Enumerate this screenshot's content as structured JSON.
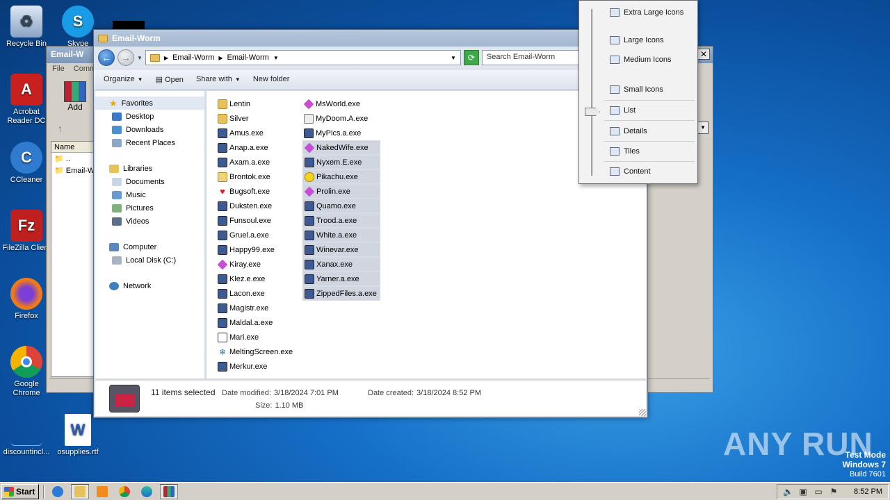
{
  "desktop": {
    "icons": [
      {
        "label": "Recycle Bin",
        "icon": "recycle-bin-icon",
        "color": "#9fb8d8"
      },
      {
        "label": "Acrobat Reader DC",
        "icon": "acrobat-icon",
        "color": "#c8201e"
      },
      {
        "label": "CCleaner",
        "icon": "ccleaner-icon",
        "color": "#2f7bd0"
      },
      {
        "label": "FileZilla Client",
        "icon": "filezilla-icon",
        "color": "#bf1f1f"
      },
      {
        "label": "Firefox",
        "icon": "firefox-icon",
        "color": "#f07a1a"
      },
      {
        "label": "Google Chrome",
        "icon": "chrome-icon",
        "color": "#e9b400"
      },
      {
        "label": "Skype",
        "icon": "skype-icon",
        "color": "#1a9be6"
      },
      {
        "label": "discountincl...",
        "icon": "file-icon",
        "color": "#3a6fb8"
      },
      {
        "label": "osupplies.rtf",
        "icon": "word-document-icon",
        "color": "#2b5bb5"
      }
    ],
    "watermark": "ANY RUN",
    "test_mode": {
      "line1": "Test Mode",
      "line2": "Windows 7",
      "line3": "Build 7601"
    }
  },
  "winrar": {
    "title": "Email-W",
    "menu": [
      "File",
      "Comm"
    ],
    "add_label": "Add",
    "column_name": "Name",
    "rows": [
      "..",
      "Email-W"
    ]
  },
  "explorer": {
    "title": "Email-Worm",
    "breadcrumb": [
      "Email-Worm",
      "Email-Worm"
    ],
    "search_placeholder": "Search Email-Worm",
    "commands": {
      "organize": "Organize",
      "open": "Open",
      "share_with": "Share with",
      "new_folder": "New folder"
    },
    "nav": {
      "favorites": "Favorites",
      "fav_items": [
        "Desktop",
        "Downloads",
        "Recent Places"
      ],
      "libraries": "Libraries",
      "lib_items": [
        "Documents",
        "Music",
        "Pictures",
        "Videos"
      ],
      "computer": "Computer",
      "comp_items": [
        "Local Disk (C:)"
      ],
      "network": "Network"
    },
    "files_col1": [
      {
        "name": "Lentin",
        "icon": "folder-icon",
        "selected": false
      },
      {
        "name": "Silver",
        "icon": "folder-icon",
        "selected": false
      },
      {
        "name": "Amus.exe",
        "icon": "exe-icon",
        "selected": false
      },
      {
        "name": "Anap.a.exe",
        "icon": "exe-icon",
        "selected": false
      },
      {
        "name": "Axam.a.exe",
        "icon": "exe-icon",
        "selected": false
      },
      {
        "name": "Brontok.exe",
        "icon": "folder-exe-icon",
        "selected": false
      },
      {
        "name": "Bugsoft.exe",
        "icon": "heart-icon",
        "selected": false
      },
      {
        "name": "Duksten.exe",
        "icon": "exe-icon",
        "selected": false
      },
      {
        "name": "Funsoul.exe",
        "icon": "exe-icon",
        "selected": false
      },
      {
        "name": "Gruel.a.exe",
        "icon": "exe-icon",
        "selected": false
      },
      {
        "name": "Happy99.exe",
        "icon": "exe-icon",
        "selected": false
      },
      {
        "name": "Kiray.exe",
        "icon": "diamond-icon",
        "selected": false
      },
      {
        "name": "Klez.e.exe",
        "icon": "exe-icon",
        "selected": false
      },
      {
        "name": "Lacon.exe",
        "icon": "exe-icon",
        "selected": false
      },
      {
        "name": "Magistr.exe",
        "icon": "exe-icon",
        "selected": false
      },
      {
        "name": "Maldal.a.exe",
        "icon": "exe-icon",
        "selected": false
      },
      {
        "name": "Mari.exe",
        "icon": "window-icon",
        "selected": false
      },
      {
        "name": "MeltingScreen.exe",
        "icon": "snowflake-icon",
        "selected": false
      },
      {
        "name": "Merkur.exe",
        "icon": "exe-icon",
        "selected": false
      }
    ],
    "files_col2": [
      {
        "name": "MsWorld.exe",
        "icon": "diamond-icon",
        "selected": false
      },
      {
        "name": "MyDoom.A.exe",
        "icon": "document-icon",
        "selected": false
      },
      {
        "name": "MyPics.a.exe",
        "icon": "exe-icon",
        "selected": false
      },
      {
        "name": "NakedWife.exe",
        "icon": "diamond-icon",
        "selected": true
      },
      {
        "name": "Nyxem.E.exe",
        "icon": "exe-icon",
        "selected": true
      },
      {
        "name": "Pikachu.exe",
        "icon": "smiley-icon",
        "selected": true
      },
      {
        "name": "Prolin.exe",
        "icon": "diamond-icon",
        "selected": true
      },
      {
        "name": "Quamo.exe",
        "icon": "exe-icon",
        "selected": true
      },
      {
        "name": "Trood.a.exe",
        "icon": "exe-icon",
        "selected": true
      },
      {
        "name": "White.a.exe",
        "icon": "exe-icon",
        "selected": true
      },
      {
        "name": "Winevar.exe",
        "icon": "exe-icon",
        "selected": true
      },
      {
        "name": "Xanax.exe",
        "icon": "exe-icon",
        "selected": true
      },
      {
        "name": "Yarner.a.exe",
        "icon": "exe-icon",
        "selected": true
      },
      {
        "name": "ZippedFiles.a.exe",
        "icon": "exe-icon",
        "selected": true
      }
    ],
    "details": {
      "count": "11 items selected",
      "date_modified_label": "Date modified:",
      "date_modified": "3/18/2024 7:01 PM",
      "date_created_label": "Date created:",
      "date_created": "3/18/2024 8:52 PM",
      "size_label": "Size:",
      "size": "1.10 MB"
    }
  },
  "view_menu": {
    "items": [
      "Extra Large Icons",
      "Large Icons",
      "Medium Icons",
      "Small Icons",
      "List",
      "Details",
      "Tiles",
      "Content"
    ],
    "selected": "List"
  },
  "taskbar": {
    "start": "Start",
    "clock": "8:52 PM"
  }
}
